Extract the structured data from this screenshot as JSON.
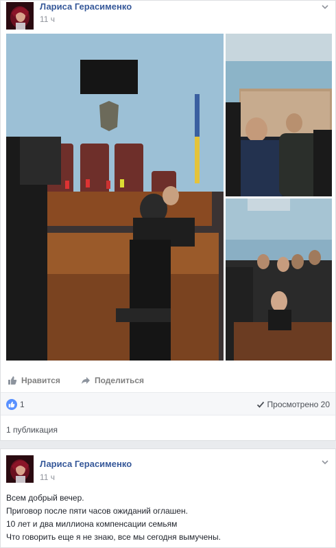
{
  "post1": {
    "author": "Лариса Герасименко",
    "time": "11 ч",
    "actions": {
      "like": "Нравится",
      "share": "Поделиться"
    },
    "stats": {
      "likes": "1",
      "views": "Просмотрено 20"
    },
    "publications": "1 публикация"
  },
  "post2": {
    "author": "Лариса Герасименко",
    "time": "11 ч",
    "text": [
      "Всем добрый вечер.",
      "Приговор после пяти часов ожиданий оглашен.",
      "10 лет и два миллиона компенсации семьям",
      "Что говорить еще я не знаю, все мы сегодня вымучены."
    ]
  },
  "icons": [
    "avatar",
    "chevron-down-icon",
    "thumbs-up-icon",
    "share-arrow-icon",
    "like-badge-icon",
    "checkmark-icon"
  ],
  "colors": {
    "link": "#365899",
    "like_badge": "#5890ff",
    "meta": "#90949c",
    "background": "#e9ebee"
  }
}
